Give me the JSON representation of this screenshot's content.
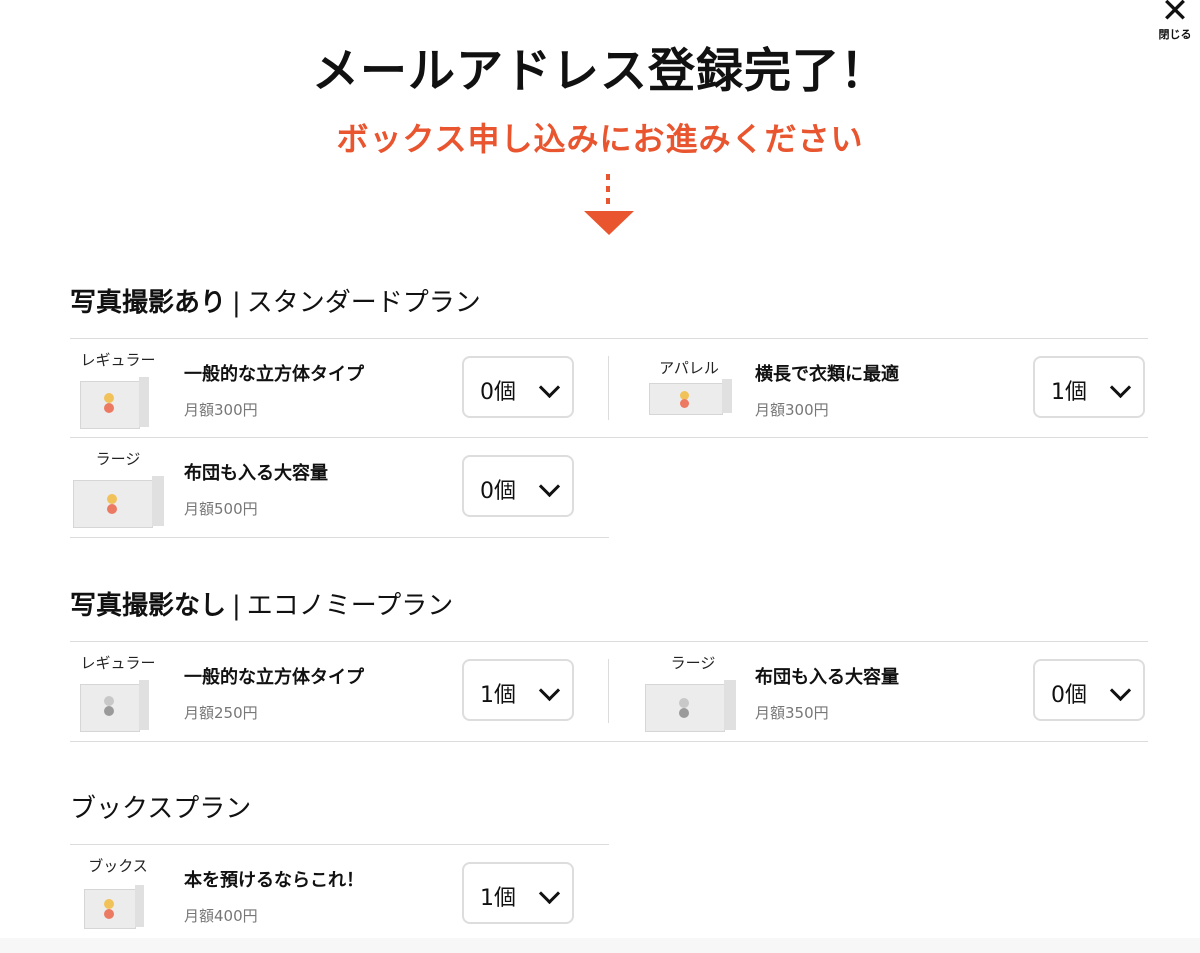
{
  "close": {
    "label": "閉じる",
    "icon": "close-icon"
  },
  "title": "メールアドレス登録完了！",
  "subtitle": "ボックス申し込みにお進みください",
  "accent_color": "#e8552f",
  "sections": {
    "standard": {
      "bold": "写真撮影あり",
      "sep": "|",
      "rest": "スタンダードプラン",
      "items": [
        {
          "box_label": "レギュラー",
          "name": "一般的な立方体タイプ",
          "price": "月額300円",
          "qty": "0個"
        },
        {
          "box_label": "アパレル",
          "name": "横長で衣類に最適",
          "price": "月額300円",
          "qty": "1個"
        },
        {
          "box_label": "ラージ",
          "name": "布団も入る大容量",
          "price": "月額500円",
          "qty": "0個"
        }
      ]
    },
    "economy": {
      "bold": "写真撮影なし",
      "sep": "|",
      "rest": "エコノミープラン",
      "items": [
        {
          "box_label": "レギュラー",
          "name": "一般的な立方体タイプ",
          "price": "月額250円",
          "qty": "1個"
        },
        {
          "box_label": "ラージ",
          "name": "布団も入る大容量",
          "price": "月額350円",
          "qty": "0個"
        }
      ]
    },
    "book": {
      "rest": "ブックスプラン",
      "items": [
        {
          "box_label": "ブックス",
          "name": "本を預けるならこれ！",
          "price": "月額400円",
          "qty": "1個"
        }
      ]
    }
  }
}
